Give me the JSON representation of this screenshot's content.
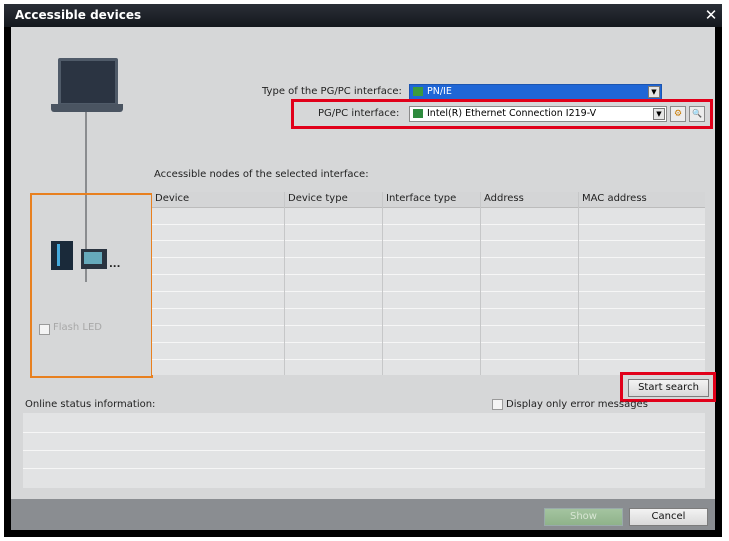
{
  "window": {
    "title": "Accessible devices",
    "close_glyph": "✕"
  },
  "topology": {
    "flash_led_label": "Flash LED",
    "ellipsis": "..."
  },
  "interface": {
    "type_label": "Type of the PG/PC interface:",
    "type_value": "PN/IE",
    "pgpc_label": "PG/PC interface:",
    "pgpc_value": "Intel(R) Ethernet Connection I219-V",
    "dropdown_glyph": "▼",
    "properties_glyph": "⚙",
    "diagnostics_glyph": "🔍"
  },
  "nodes": {
    "heading": "Accessible nodes of the selected interface:",
    "columns": [
      "Device",
      "Device type",
      "Interface type",
      "Address",
      "MAC address"
    ],
    "rows": []
  },
  "actions": {
    "start_search": "Start search"
  },
  "status": {
    "heading": "Online status information:",
    "error_only_label": "Display only error messages"
  },
  "footer": {
    "show": "Show",
    "cancel": "Cancel"
  },
  "colors": {
    "highlight_red": "#e1001a",
    "orange_frame": "#e8801f",
    "dropdown_blue": "#1f66d6"
  }
}
